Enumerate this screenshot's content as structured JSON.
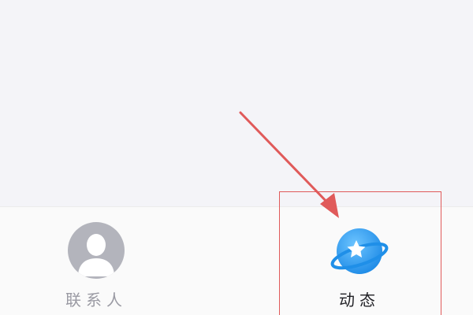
{
  "tab_bar": {
    "tabs": [
      {
        "id": "contacts",
        "label": "联系人",
        "icon": "person-silhouette-icon",
        "selected": false
      },
      {
        "id": "moments",
        "label": "动态",
        "icon": "planet-star-icon",
        "selected": true
      }
    ]
  },
  "annotation": {
    "type": "red-arrow-and-box",
    "target": "moments",
    "color": "#e05a5a"
  },
  "colors": {
    "contacts_icon": "#b3b4bc",
    "moments_icon_blue": "#2f9ef0",
    "inactive_label": "#9a9aa3",
    "active_label": "#1f1f24"
  }
}
